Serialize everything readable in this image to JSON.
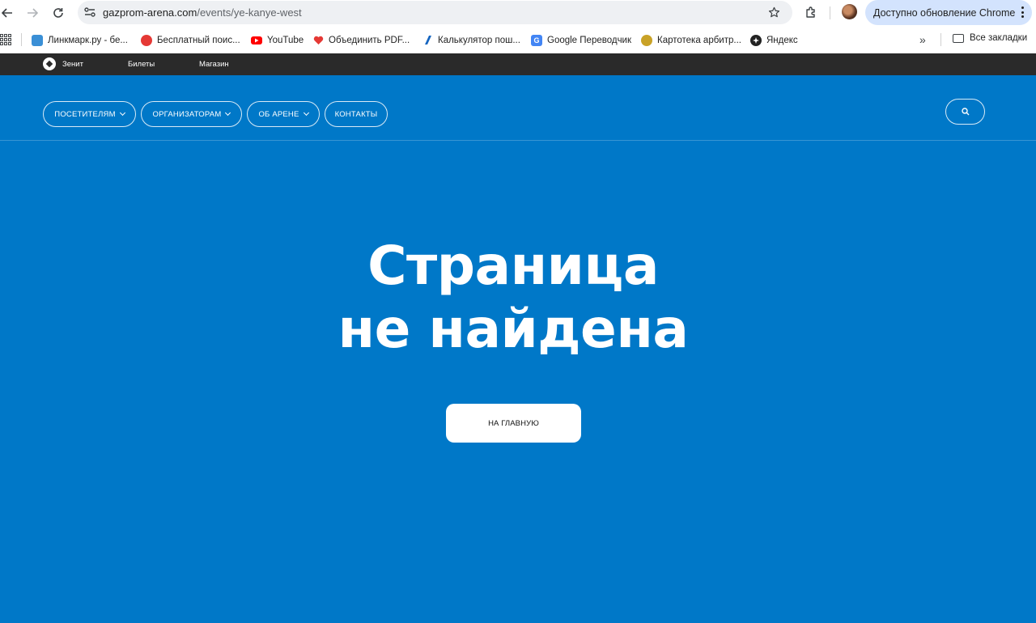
{
  "browser": {
    "url_host": "gazprom-arena.com",
    "url_path": "/events/ye-kanye-west",
    "update_label": "Доступно обновление Chrome"
  },
  "bookmarks": {
    "items": [
      {
        "label": "Линкмарк.ру - бе...",
        "icon": "linkmark-icon",
        "color": "#3a8fd6"
      },
      {
        "label": "Бесплатный поис...",
        "icon": "search-red-icon",
        "color": "#e53935"
      },
      {
        "label": "YouTube",
        "icon": "youtube-icon",
        "color": "#ff0000"
      },
      {
        "label": "Объединить PDF...",
        "icon": "pdf-heart-icon",
        "color": "#e53935"
      },
      {
        "label": "Калькулятор пош...",
        "icon": "calculator-icon",
        "color": "#1565c0"
      },
      {
        "label": "Google Переводчик",
        "icon": "google-translate-icon",
        "color": "#4285f4"
      },
      {
        "label": "Картотека арбитр...",
        "icon": "emblem-icon",
        "color": "#b8860b"
      },
      {
        "label": "Яндекс",
        "icon": "yandex-icon",
        "color": "#222222"
      }
    ],
    "more": "»",
    "all_label": "Все закладки"
  },
  "sitebar": {
    "links": [
      "Зенит",
      "Билеты",
      "Магазин"
    ]
  },
  "nav": {
    "items": [
      {
        "label": "ПОСЕТИТЕЛЯМ",
        "dropdown": true
      },
      {
        "label": "ОРГАНИЗАТОРАМ",
        "dropdown": true
      },
      {
        "label": "ОБ АРЕНЕ",
        "dropdown": true
      },
      {
        "label": "КОНТАКТЫ",
        "dropdown": false
      }
    ]
  },
  "hero": {
    "title_line1": "Страница",
    "title_line2": "не найдена",
    "button": "НА ГЛАВНУЮ"
  },
  "colors": {
    "page_bg": "#0078c8",
    "sitebar_bg": "#2a2a2a"
  }
}
